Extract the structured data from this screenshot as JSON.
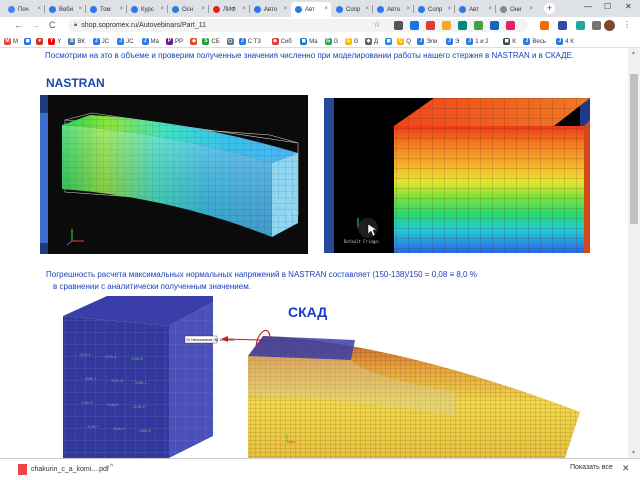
{
  "tabs": [
    {
      "label": "Поч",
      "color": "#4285f4"
    },
    {
      "label": "Веби",
      "color": "#2c7be5",
      "jc": true
    },
    {
      "label": "Том",
      "color": "#2c7be5",
      "jc": true
    },
    {
      "label": "Курс",
      "color": "#2c7be5",
      "jc": true
    },
    {
      "label": "Осн",
      "color": "#2c7be5",
      "jc": true
    },
    {
      "label": "ЛИФ",
      "color": "#e62117"
    },
    {
      "label": "Авто",
      "color": "#2c7be5",
      "jc": true
    },
    {
      "label": "Авт",
      "color": "#2c7be5",
      "jc": true,
      "active": true
    },
    {
      "label": "Сопр",
      "color": "#2c7be5",
      "jc": true
    },
    {
      "label": "Авто",
      "color": "#2c7be5",
      "jc": true
    },
    {
      "label": "Сопр",
      "color": "#2c7be5",
      "jc": true
    },
    {
      "label": "Авт",
      "color": "#2c7be5",
      "jc": true
    },
    {
      "label": "Они",
      "color": "#888888"
    }
  ],
  "new_tab": "+",
  "window_controls": {
    "minimize": "—",
    "maximize": "☐",
    "close": "✕"
  },
  "toolbar": {
    "back": "←",
    "forward": "→",
    "reload": "C",
    "url": "shop.sopromex.ru/Autovebinars/Part_11",
    "star": "☆"
  },
  "bookmarks": [
    {
      "label": "М",
      "color": "#ea4335",
      "icon": "M"
    },
    {
      "label": "",
      "color": "#1a73e8",
      "icon": "◼"
    },
    {
      "label": "",
      "color": "#d93025",
      "icon": "♥"
    },
    {
      "label": "Y",
      "color": "#ff0000",
      "icon": "Y"
    },
    {
      "label": "ВК",
      "color": "#4a76a8",
      "icon": "B"
    },
    {
      "label": "JC",
      "color": "#2c7be5",
      "icon": "J"
    },
    {
      "label": "JC",
      "color": "#2c7be5",
      "icon": "J"
    },
    {
      "label": "Ма",
      "color": "#2c7be5",
      "icon": "J"
    },
    {
      "label": "РР",
      "color": "#6a1b9a",
      "icon": "P"
    },
    {
      "label": "",
      "color": "#e64a19",
      "icon": "◆"
    },
    {
      "label": "СБ",
      "color": "#21a038",
      "icon": "S"
    },
    {
      "label": "",
      "color": "#607d8b",
      "icon": "◻"
    },
    {
      "label": "С Т3",
      "color": "#2c7be5",
      "icon": "J"
    },
    {
      "label": "Сиб",
      "color": "#e53935",
      "icon": "◆"
    },
    {
      "label": "Ма",
      "color": "#1976d2",
      "icon": "◼"
    },
    {
      "label": "G",
      "color": "#34a853",
      "icon": "G"
    },
    {
      "label": "G",
      "color": "#fbbc05",
      "icon": "G"
    },
    {
      "label": "Д",
      "color": "#5f6368",
      "icon": "◆"
    },
    {
      "label": "",
      "color": "#1e88e5",
      "icon": "◼"
    },
    {
      "label": "Q",
      "color": "#ffb300",
      "icon": "Q"
    },
    {
      "label": "Эли",
      "color": "#2c7be5",
      "icon": "J"
    },
    {
      "label": "Э",
      "color": "#2c7be5",
      "icon": "J"
    },
    {
      "label": "1 и 2",
      "color": "#2c7be5",
      "icon": "J"
    },
    {
      "label": "К",
      "color": "#37474f",
      "icon": "◼"
    },
    {
      "label": "Весь",
      "color": "#2c7be5",
      "icon": "J"
    },
    {
      "label": "4 К",
      "color": "#2c7be5",
      "icon": "J"
    }
  ],
  "content": {
    "intro": "Посмотрим на это в объеме и проверим полученные значения численно при моделировании работы нашего стержня в NASTRAN и в СКАДЕ.",
    "nastran_heading": "NASTRAN",
    "error_line1": "Погрешность расчета максимальных нормальных напряжений в NASTRAN  составляет (150-138)/150 = 0,08  ≡  8,0 %",
    "error_line2": "в сравнении с аналитически полученным значением.",
    "skad_heading": "СКАД",
    "skad_callout": "10  Напряжения (N) 150.5662"
  },
  "downloads": {
    "file": "chakurin_c_a_komi....pdf",
    "chevron": "^",
    "show_all": "Показать все",
    "close": "✕"
  },
  "colors": {
    "link_blue": "#1a3fb8",
    "heading_blue": "#1a49a8",
    "skad_blue": "#1a38c8"
  }
}
